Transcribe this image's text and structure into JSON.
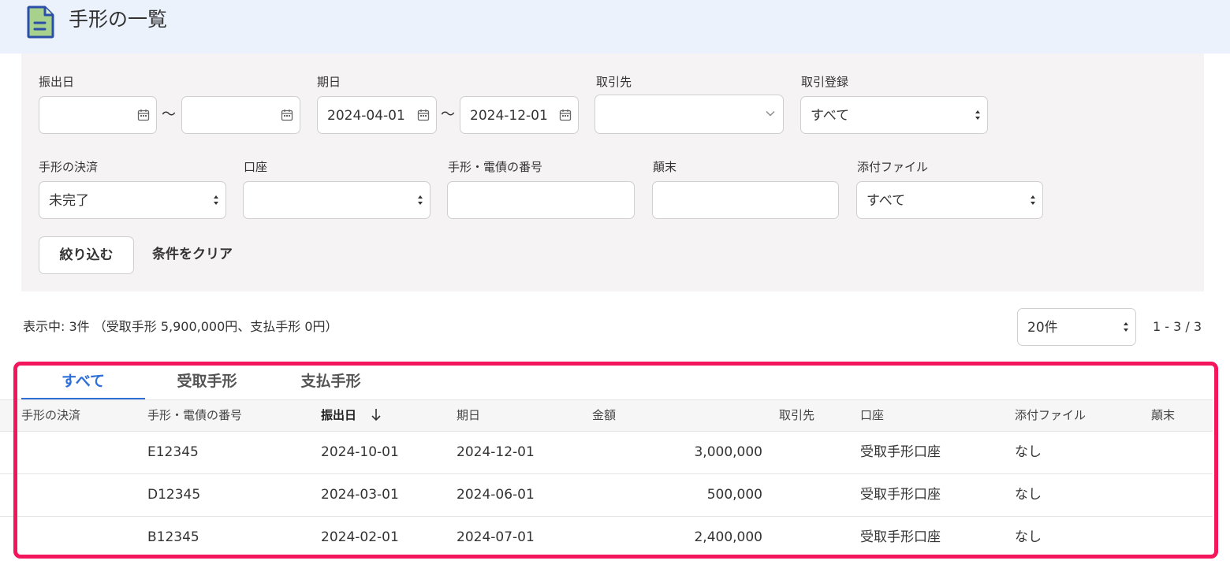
{
  "header": {
    "title": "手形の一覧",
    "icon": "document-icon"
  },
  "filters": {
    "issue_date": {
      "label": "振出日",
      "from": "",
      "to": ""
    },
    "due_date": {
      "label": "期日",
      "from": "2024-04-01",
      "to": "2024-12-01"
    },
    "range_separator": "〜",
    "partner": {
      "label": "取引先",
      "value": ""
    },
    "transaction_registration": {
      "label": "取引登録",
      "value": "すべて"
    },
    "settlement": {
      "label": "手形の決済",
      "value": "未完了"
    },
    "account": {
      "label": "口座",
      "value": ""
    },
    "bill_number": {
      "label": "手形・電債の番号",
      "value": ""
    },
    "term_end": {
      "label": "顛末",
      "value": ""
    },
    "attachment": {
      "label": "添付ファイル",
      "value": "すべて"
    },
    "apply_button": "絞り込む",
    "clear_button": "条件をクリア"
  },
  "summary": {
    "text": "表示中: 3件 （受取手形 5,900,000円、支払手形 0円）",
    "per_page": "20件",
    "range": "1 - 3 / 3"
  },
  "tabs": [
    {
      "label": "すべて",
      "active": true
    },
    {
      "label": "受取手形",
      "active": false
    },
    {
      "label": "支払手形",
      "active": false
    }
  ],
  "table": {
    "columns": [
      "手形の決済",
      "手形・電債の番号",
      "振出日",
      "期日",
      "金額",
      "取引先",
      "口座",
      "添付ファイル",
      "顛末"
    ],
    "sorted_column": "振出日",
    "rows": [
      {
        "settlement": "",
        "number": "E12345",
        "issue_date": "2024-10-01",
        "due_date": "2024-12-01",
        "amount": "3,000,000",
        "partner": "",
        "account": "受取手形口座",
        "attachment": "なし",
        "term_end": ""
      },
      {
        "settlement": "",
        "number": "D12345",
        "issue_date": "2024-03-01",
        "due_date": "2024-06-01",
        "amount": "500,000",
        "partner": "",
        "account": "受取手形口座",
        "attachment": "なし",
        "term_end": ""
      },
      {
        "settlement": "",
        "number": "B12345",
        "issue_date": "2024-02-01",
        "due_date": "2024-07-01",
        "amount": "2,400,000",
        "partner": "",
        "account": "受取手形口座",
        "attachment": "なし",
        "term_end": ""
      }
    ]
  },
  "colors": {
    "header_bg": "#ebf2fc",
    "panel_bg": "#f5f3f3",
    "accent_blue": "#2f6fd8",
    "highlight_border": "#f3165d",
    "icon_green": "#a9d18e",
    "icon_blue": "#2b4fa8"
  }
}
